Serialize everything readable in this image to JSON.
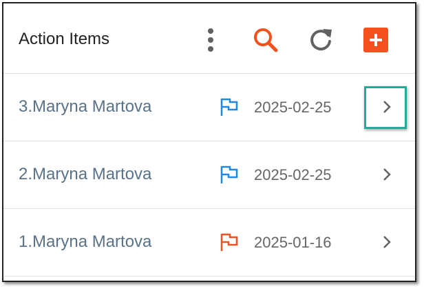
{
  "header": {
    "title": "Action Items",
    "icons": [
      "more-vertical-icon",
      "search-icon",
      "refresh-icon",
      "add-icon"
    ]
  },
  "colors": {
    "accent": "#f4511e",
    "flag_blue": "#1e88e5",
    "flag_orange": "#f4511e",
    "name_text": "#5a7288",
    "highlight": "#24a99a"
  },
  "items": [
    {
      "name": "3.Maryna Martova",
      "date": "2025-02-25",
      "flag": "blue"
    },
    {
      "name": "2.Maryna Martova",
      "date": "2025-02-25",
      "flag": "blue"
    },
    {
      "name": "1.Maryna Martova",
      "date": "2025-01-16",
      "flag": "orange"
    }
  ]
}
